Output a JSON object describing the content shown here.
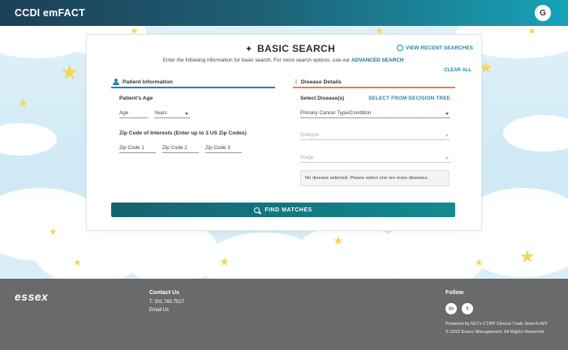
{
  "header": {
    "title": "CCDI emFACT",
    "avatar_initial": "G"
  },
  "card": {
    "title": "BASIC SEARCH",
    "view_recent": "VIEW RECENT SEARCHES",
    "intro_text": "Enter the following information for basic search. For more search options, use our",
    "advanced_link": "ADVANCED SEARCH",
    "intro_end": ".",
    "clear_all": "CLEAR ALL",
    "patient_section": "Patient Information",
    "disease_section": "Disease Details",
    "patients_age_label": "Patient's Age",
    "age_placeholder": "Age",
    "age_unit": "Years",
    "zip_label": "Zip Code of Interests (Enter up to 3 US Zip Codes)",
    "zip1": "Zip Code 1",
    "zip2": "Zip Code 2",
    "zip3": "Zip Code 3",
    "select_disease_label": "Select Disease(s)",
    "decision_tree": "SELECT FROM DECISION TREE",
    "primary_cancer": "Primary Cancer Type/Condition",
    "subtype": "Subtype",
    "stage": "Stage",
    "no_disease": "No disease selected. Please select one ore more diseases.",
    "find_matches": "FIND MATCHES"
  },
  "footer": {
    "logo": "essex",
    "contact_title": "Contact Us",
    "phone": "T: 301.760.7527",
    "email": "Email Us",
    "follow": "Follow",
    "linkedin": "in",
    "twitter": "t",
    "powered": "Powered by NCI's CTRP Clinical Trials Search API",
    "copyright": "© 2022 Essex Management. All Rights Reserved"
  },
  "colors": {
    "accent": "#1e88a8",
    "button": "#128a92",
    "footer": "#6a6a6a",
    "star": "#f6d55c"
  }
}
